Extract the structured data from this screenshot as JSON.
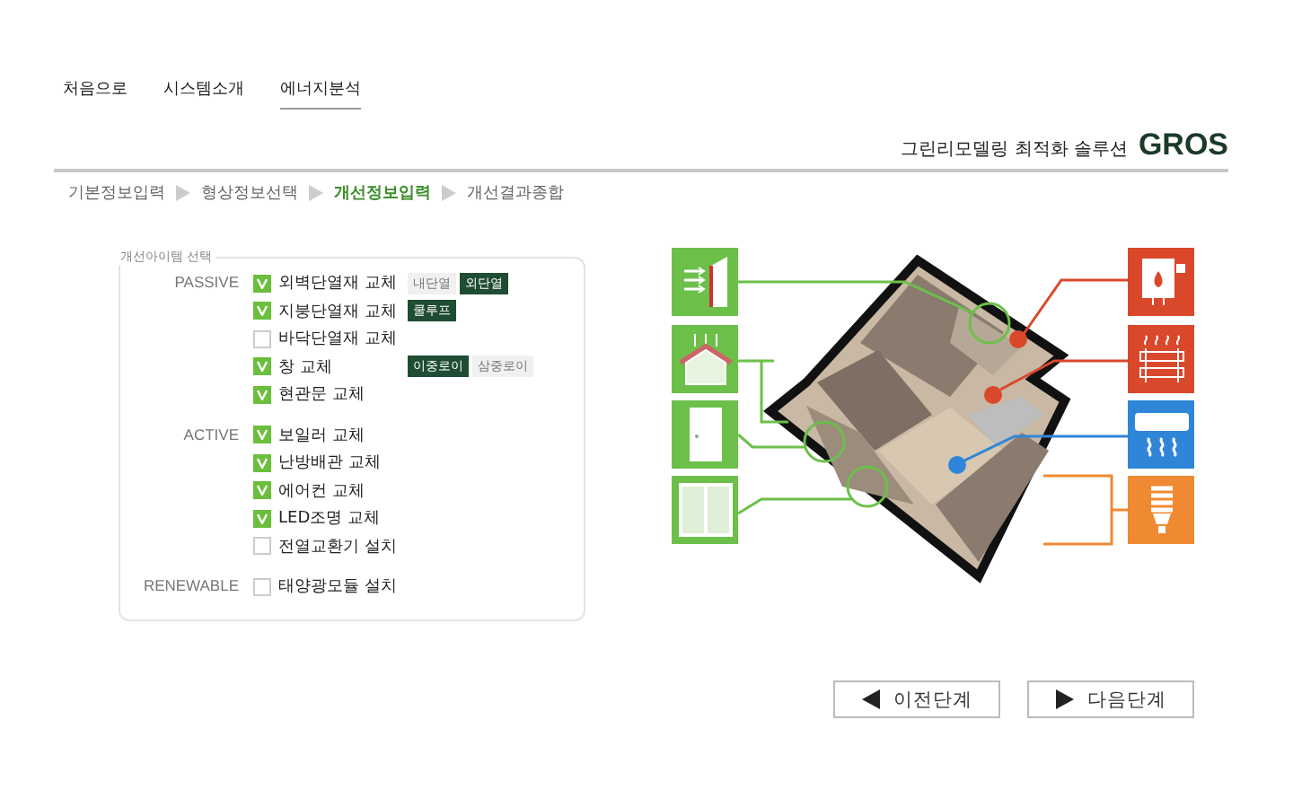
{
  "top_nav": [
    {
      "label": "처음으로",
      "selected": false
    },
    {
      "label": "시스템소개",
      "selected": false
    },
    {
      "label": "에너지분석",
      "selected": true
    }
  ],
  "header": {
    "subtitle": "그린리모델링 최적화 솔루션",
    "brand": "GROS"
  },
  "steps": [
    {
      "label": "기본정보입력",
      "selected": false
    },
    {
      "label": "형상정보선택",
      "selected": false
    },
    {
      "label": "개선정보입력",
      "selected": true
    },
    {
      "label": "개선결과종합",
      "selected": false
    }
  ],
  "panel": {
    "legend": "개선아이템 선택",
    "groups": [
      {
        "label": "PASSIVE",
        "items": [
          {
            "label": "외벽단열재 교체",
            "checked": true,
            "tags": [
              {
                "label": "내단열",
                "selected": false
              },
              {
                "label": "외단열",
                "selected": true
              }
            ]
          },
          {
            "label": "지붕단열재 교체",
            "checked": true,
            "tags": [
              {
                "label": "쿨루프",
                "selected": true
              }
            ]
          },
          {
            "label": "바닥단열재 교체",
            "checked": false
          },
          {
            "label": "창 교체",
            "checked": true,
            "tags": [
              {
                "label": "이중로이",
                "selected": true
              },
              {
                "label": "삼중로이",
                "selected": false
              }
            ]
          },
          {
            "label": "현관문 교체",
            "checked": true
          }
        ]
      },
      {
        "label": "ACTIVE",
        "items": [
          {
            "label": "보일러 교체",
            "checked": true
          },
          {
            "label": "난방배관 교체",
            "checked": true
          },
          {
            "label": "에어컨 교체",
            "checked": true
          },
          {
            "label": "LED조명 교체",
            "checked": true
          },
          {
            "label": "전열교환기 설치",
            "checked": false
          }
        ]
      },
      {
        "label": "RENEWABLE",
        "items": [
          {
            "label": "태양광모듈 설치",
            "checked": false
          }
        ]
      }
    ]
  },
  "diagram": {
    "left_tiles": [
      {
        "kind": "wall",
        "color": "#6cc04a"
      },
      {
        "kind": "roof",
        "color": "#6cc04a"
      },
      {
        "kind": "door",
        "color": "#6cc04a"
      },
      {
        "kind": "window",
        "color": "#6cc04a"
      }
    ],
    "right_tiles": [
      {
        "kind": "boiler",
        "color": "#d9482b"
      },
      {
        "kind": "pipe",
        "color": "#d9482b"
      },
      {
        "kind": "aircon",
        "color": "#2f86d8"
      },
      {
        "kind": "lamp",
        "color": "#ef8a32"
      }
    ]
  },
  "buttons": [
    {
      "kind": "prev",
      "label": "이전단계"
    },
    {
      "kind": "next",
      "label": "다음단계"
    }
  ]
}
